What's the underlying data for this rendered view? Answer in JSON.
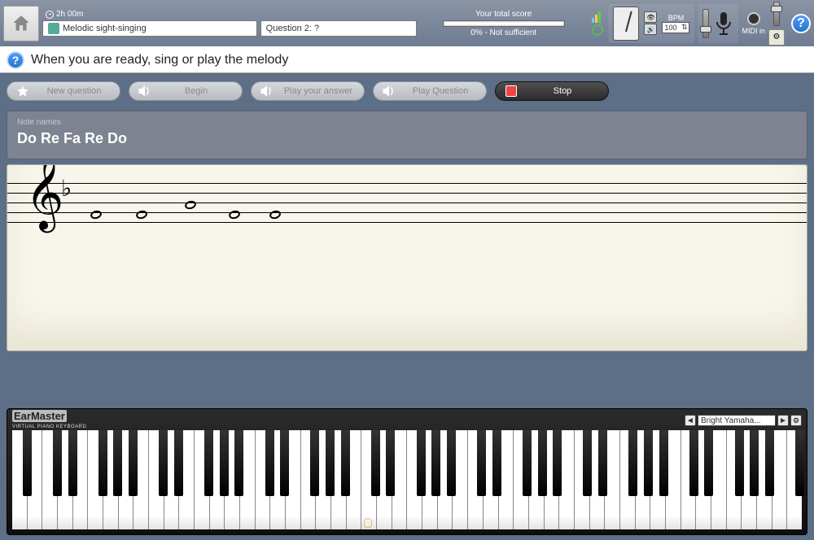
{
  "topbar": {
    "time": "2h 00m",
    "exercise": "Melodic sight-singing",
    "question": "Question 2: ?",
    "score_label": "Your total score",
    "score_text": "0% - Not sufficient",
    "bpm_label": "BPM",
    "bpm_value": "100",
    "midi_label": "MIDI in"
  },
  "instruction": "When you are ready, sing or play the melody",
  "actions": {
    "new_question": "New question",
    "begin": "Begin",
    "play_answer": "Play your answer",
    "play_question": "Play Question",
    "stop": "Stop"
  },
  "notes_panel": {
    "header": "Note names",
    "names": "Do Re Fa Re Do"
  },
  "piano": {
    "brand": "EarMaster",
    "subbrand": "VIRTUAL PIANO KEYBOARD",
    "preset": "Bright Yamaha..."
  },
  "staff": {
    "notes_y": [
      56,
      56,
      44,
      56,
      56
    ],
    "notes_x": [
      102,
      158,
      218,
      272,
      322
    ]
  }
}
